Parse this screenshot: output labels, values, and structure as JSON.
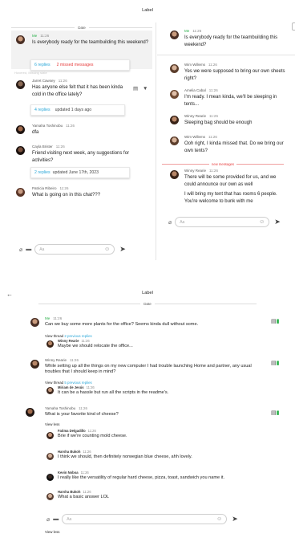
{
  "screen1": {
    "header": "Label",
    "date": "Date",
    "left_messages": [
      {
        "name": "Me",
        "time": "11:26",
        "text": "Is everybody ready for the teambuilding this weekend?",
        "replies": "6 replies",
        "missed": "2 missed messages",
        "ghost": "Hovered, Missing state"
      },
      {
        "name": "Jarret Cawsey",
        "time": "11:26",
        "text": "Has anyone else felt that it has been kinda cold in the office lately?",
        "replies": "4 replies",
        "updated": "updated 1 days ago"
      },
      {
        "name": "Yamaha Toshinobu",
        "time": "11:26",
        "text": "dfa"
      },
      {
        "name": "Cayla Brister",
        "time": "11:26",
        "text": "Friend visiting next week, any suggestions for activities?",
        "replies": "2 replies",
        "updated": "updated June 17th, 2023"
      },
      {
        "name": "Patricia Ribeiro",
        "time": "11:26",
        "text": "What is going on in this chat???"
      }
    ],
    "left_composer_placeholder": "Aa",
    "right_root": {
      "name": "Me",
      "time": "11:26",
      "text": "Is everybody ready for the teambuilding this weekend?"
    },
    "right_messages": [
      {
        "name": "Wim Willems",
        "time": "11:26",
        "text": "Yes we were supposed to bring our own sheets right?"
      },
      {
        "name": "Amelia Cabal",
        "time": "11:26",
        "text": "I'm ready. I mean kinda, we'll be sleeping in tents..."
      },
      {
        "name": "Winny Rearie",
        "time": "11:26",
        "text": "Sleeping bag should be enough"
      },
      {
        "name": "Wim Willems",
        "time": "11:26",
        "text": "Ooh right, I kinda missed that. Do we bring our own tents?"
      }
    ],
    "new_messages_label": "new messages",
    "right_new": {
      "name": "Winny Rearie",
      "time": "11:26",
      "text1": "There will be some provided for us, and we could announce our own as well",
      "text2": "I will bring my tent that has rooms 6 people. You're welcome to bunk with me"
    },
    "right_composer_placeholder": "Aa"
  },
  "screen2": {
    "header": "Label",
    "date": "Date",
    "msg1": {
      "name": "Me",
      "time": "11:26",
      "text": "Can we buy some more plants for the office? Seems kinda dull without some.",
      "view_thread": "View thread",
      "prev_replies": "2 previous replies",
      "reply_name": "Winny Rearie",
      "reply_time": "11:26",
      "reply_text": "Maybe we should relocate the office..."
    },
    "msg2": {
      "name": "Winny Rearie",
      "time": "11:26",
      "text": "While setting up all the things on my new computer I had trouble launching Home and partner, any usual troubles that I should keep in mind?",
      "view_thread": "View thread",
      "prev_replies": "5 previous replies",
      "reply_name": "Miriam de Jesús",
      "reply_time": "11:26",
      "reply_text": "It can be a hassle but run all the scripts in the readme's."
    },
    "msg3": {
      "name": "Yamaha Toshinobu",
      "time": "11:26",
      "text": "What is your favorite kind of cheese?",
      "view_less": "View less",
      "replies": [
        {
          "name": "Fatima Delgadillo",
          "time": "11:26",
          "text": "Brie if we're counting mold cheese."
        },
        {
          "name": "Harsha Bukoh",
          "time": "11:26",
          "text": "I think we should, then definitely norwegian blue cheese, ahh lovely."
        },
        {
          "name": "Kevin Noboa",
          "time": "11:26",
          "text": "I really like the versatility of regular hard cheese, pizza, toast, sandwich you name it."
        },
        {
          "name": "Harsha Bukoh",
          "time": "11:26",
          "text": "What a basic answer LOL"
        }
      ],
      "composer_placeholder": "Aa",
      "view_less_bottom": "View less"
    }
  },
  "colors": {
    "me_green": "#2ab04a",
    "link_blue": "#2aa7d8",
    "alert_red": "#e63b3b"
  },
  "icons": [
    "paperclip-icon",
    "sticker-icon",
    "emoji-icon",
    "send-icon",
    "thread-icon",
    "pin-icon",
    "back-arrow-icon"
  ]
}
